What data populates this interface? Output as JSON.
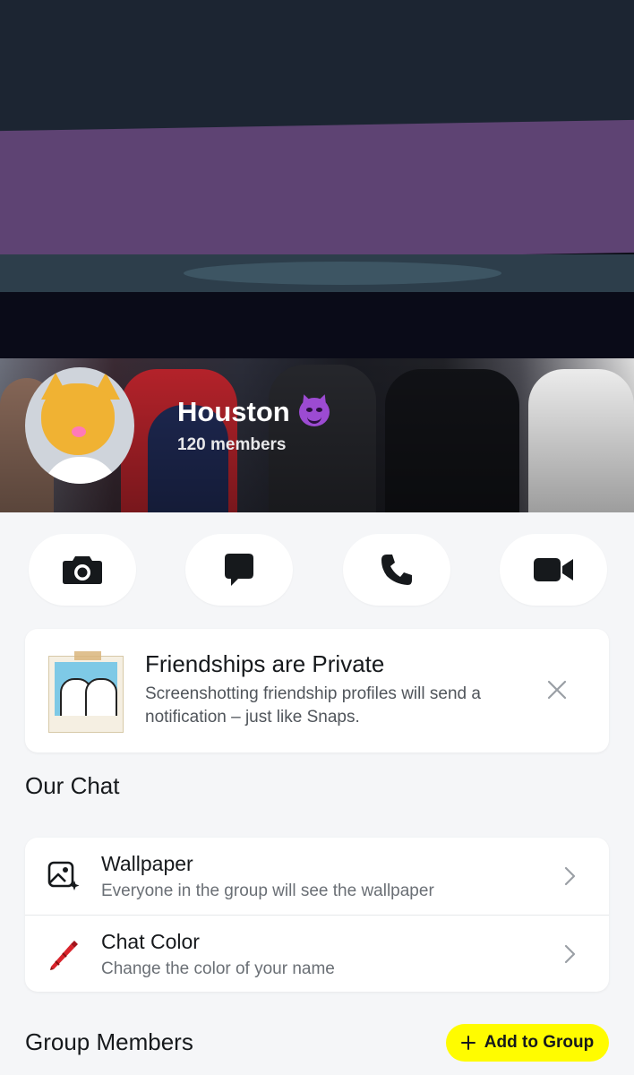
{
  "header": {
    "group_name": "Houston",
    "group_emoji": "smiling-devil-emoji",
    "member_count": "120 members"
  },
  "actions": [
    {
      "name": "camera",
      "icon": "camera-icon"
    },
    {
      "name": "chat",
      "icon": "chat-bubble-icon"
    },
    {
      "name": "call",
      "icon": "phone-icon"
    },
    {
      "name": "video",
      "icon": "video-camera-icon"
    }
  ],
  "notice": {
    "title": "Friendships are Private",
    "text": "Screenshotting friendship profiles will send a notification – just like Snaps."
  },
  "our_chat": {
    "heading": "Our Chat",
    "items": [
      {
        "title": "Wallpaper",
        "subtitle": "Everyone in the group will see the wallpaper",
        "icon": "wallpaper-icon"
      },
      {
        "title": "Chat Color",
        "subtitle": "Change the color of your name",
        "icon": "crayon-icon"
      }
    ]
  },
  "group_members": {
    "heading": "Group Members",
    "add_button": "Add to Group"
  },
  "colors": {
    "accent_yellow": "#fffc00",
    "background": "#f5f6f8",
    "banner_purple": "#5e4373"
  }
}
